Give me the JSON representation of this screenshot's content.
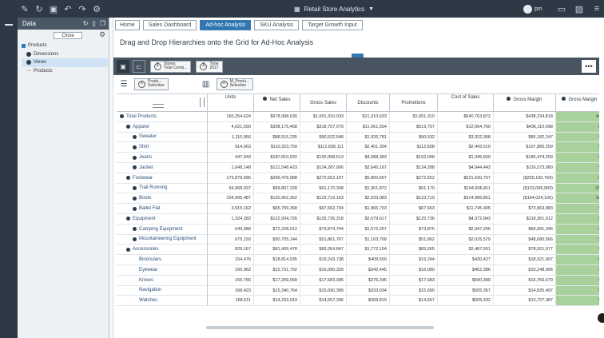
{
  "app": {
    "title": "Retail Store Analytics",
    "user": "pm"
  },
  "datapanel": {
    "title": "Data",
    "close_label": "Close",
    "tree": [
      {
        "label": "Products",
        "level": 0,
        "icon": "blue-square-icon"
      },
      {
        "label": "Dimensions",
        "level": 1,
        "icon": "plus-icon"
      },
      {
        "label": "Views",
        "level": 1,
        "icon": "plus-icon",
        "selected": true
      },
      {
        "label": "Products",
        "level": 1,
        "icon": "leaf-icon"
      }
    ]
  },
  "tabs": [
    {
      "label": "Home",
      "active": false
    },
    {
      "label": "Sales Dashboard",
      "active": false
    },
    {
      "label": "Ad-hoc Analysis",
      "active": true
    },
    {
      "label": "SKU Analysis",
      "active": false
    },
    {
      "label": "Target Growth Input",
      "active": false
    }
  ],
  "page_title": "Drag and Drop Hierarchies onto the Grid for  Ad-Hoc Analysis",
  "context_chips": [
    {
      "line1": "Stores",
      "line2": "Total Comp..."
    },
    {
      "line1": "Time",
      "line2": "2017"
    }
  ],
  "row_chip": {
    "line1": "Produ...",
    "line2": "Selection"
  },
  "col_chip": {
    "line1": "M_Produ...",
    "line2": "Selection"
  },
  "columns": [
    {
      "label": "Units",
      "expand": false
    },
    {
      "label": "Net Sales",
      "expand": true
    },
    {
      "label": "Gross Sales",
      "expand": false
    },
    {
      "label": "Discounts",
      "expand": false
    },
    {
      "label": "Promotions",
      "expand": false
    },
    {
      "label": "Cost of Sales",
      "expand": false
    },
    {
      "label": "Gross Margin",
      "expand": true
    },
    {
      "label": "Gross Margin",
      "expand": true
    }
  ],
  "rows": [
    {
      "label": "Total Products",
      "level": 0,
      "expand": true,
      "values": [
        "160,254,624",
        "$978,998,630",
        "$1,001,310,033",
        "$21,310,633",
        "$1,001,310",
        "$540,763,872",
        "$438,234,818",
        "44"
      ]
    },
    {
      "label": "Apparel",
      "level": 1,
      "expand": true,
      "values": [
        "4,021,590",
        "$308,175,468",
        "$318,757,079",
        "$11,061,554",
        "$519,757",
        "$12,064,760",
        "$436,110,698",
        "5"
      ]
    },
    {
      "label": "Sweater",
      "level": 2,
      "expand": true,
      "values": [
        "1,110,956",
        "$88,515,235",
        "$90,532,548",
        "$1,926,781",
        "$90,532",
        "$3,332,368",
        "$85,182,247",
        "9"
      ]
    },
    {
      "label": "Shirt",
      "level": 2,
      "expand": true,
      "values": [
        "914,063",
        "$110,323,759",
        "$112,838,111",
        "$2,401,304",
        "$112,838",
        "$2,443,510",
        "$107,880,259",
        "9"
      ]
    },
    {
      "label": "Jeans",
      "level": 2,
      "expand": true,
      "values": [
        "447,943",
        "$187,810,032",
        "$192,098,513",
        "$4,088,383",
        "$192,098",
        "$1,345,829",
        "$186,474,203",
        "9"
      ]
    },
    {
      "label": "Jacket",
      "level": 2,
      "expand": true,
      "values": [
        "1,648,148",
        "$121,548,423",
        "$124,287,906",
        "$2,645,167",
        "$124,288",
        "$4,944,443",
        "$116,573,980",
        "9"
      ]
    },
    {
      "label": "Footwear",
      "level": 1,
      "expand": true,
      "values": [
        "173,879,586",
        "$266,478,988",
        "$272,552,197",
        "$5,800,657",
        "$272,552",
        "$521,630,757",
        "($255,150,769)",
        "-9"
      ]
    },
    {
      "label": "Trail Running",
      "level": 2,
      "expand": true,
      "values": [
        "64,968,937",
        "$59,807,228",
        "$61,170,308",
        "$1,301,872",
        "$61,170",
        "$194,906,811",
        "($133,099,583)",
        "-22"
      ]
    },
    {
      "label": "Boots",
      "level": 2,
      "expand": true,
      "values": [
        "104,995,487",
        "$120,962,362",
        "$123,719,163",
        "$2,633,083",
        "$123,719",
        "$314,986,861",
        "($194,024,100)",
        "-16"
      ]
    },
    {
      "label": "Ballet Flat",
      "level": 2,
      "expand": true,
      "values": [
        "3,915,162",
        "$65,709,368",
        "$67,662,734",
        "$1,865,703",
        "$67,663",
        "$11,745,405",
        "$73,963,883",
        "9"
      ]
    },
    {
      "label": "Equipment",
      "level": 1,
      "expand": true,
      "values": [
        "1,324,282",
        "$122,934,726",
        "$125,736,318",
        "$2,679,617",
        "$125,736",
        "$4,372,843",
        "$118,361,912",
        "9"
      ]
    },
    {
      "label": "Camping Equipment",
      "level": 2,
      "expand": true,
      "values": [
        "649,089",
        "$72,228,612",
        "$73,874,744",
        "$1,572,257",
        "$73,875",
        "$2,347,266",
        "$69,681,346",
        "9"
      ]
    },
    {
      "label": "Mountaineering Equipment",
      "level": 2,
      "expand": true,
      "values": [
        "675,193",
        "$50,705,144",
        "$51,861,767",
        "$1,103,768",
        "$51,862",
        "$2,025,579",
        "$48,680,566",
        "9"
      ]
    },
    {
      "label": "Accessories",
      "level": 1,
      "expand": true,
      "values": [
        "829,167",
        "$81,409,478",
        "$83,264,847",
        "$1,772,104",
        "$83,265",
        "$2,487,501",
        "$78,921,977",
        "9"
      ]
    },
    {
      "label": "Binoculars",
      "level": 3,
      "expand": false,
      "values": [
        "154,476",
        "$18,814,935",
        "$19,243,738",
        "$409,559",
        "$19,244",
        "$430,427",
        "$18,321,007",
        "9"
      ]
    },
    {
      "label": "Eyewear",
      "level": 3,
      "expand": false,
      "values": [
        "160,962",
        "$15,731,792",
        "$16,090,329",
        "$342,445",
        "$16,090",
        "$452,386",
        "$15,248,906",
        "9"
      ]
    },
    {
      "label": "Knives",
      "level": 3,
      "expand": false,
      "values": [
        "166,756",
        "$17,209,068",
        "$17,683,095",
        "$376,345",
        "$17,683",
        "$590,389",
        "$16,766,679",
        "9"
      ]
    },
    {
      "label": "Navigation",
      "level": 3,
      "expand": false,
      "values": [
        "168,423",
        "$15,340,764",
        "$15,690,389",
        "$333,934",
        "$15,690",
        "$505,367",
        "$14,835,497",
        "9"
      ]
    },
    {
      "label": "Watches",
      "level": 3,
      "expand": false,
      "values": [
        "168,511",
        "$14,232,919",
        "$14,557,296",
        "$309,819",
        "$14,557",
        "$505,332",
        "$13,727,387",
        "9"
      ]
    }
  ],
  "colors": {
    "accent": "#3277b0",
    "topbar": "#2d3945",
    "toolbar": "#48545f",
    "green": "#a8d19b",
    "row_text": "#2c4f7c"
  }
}
